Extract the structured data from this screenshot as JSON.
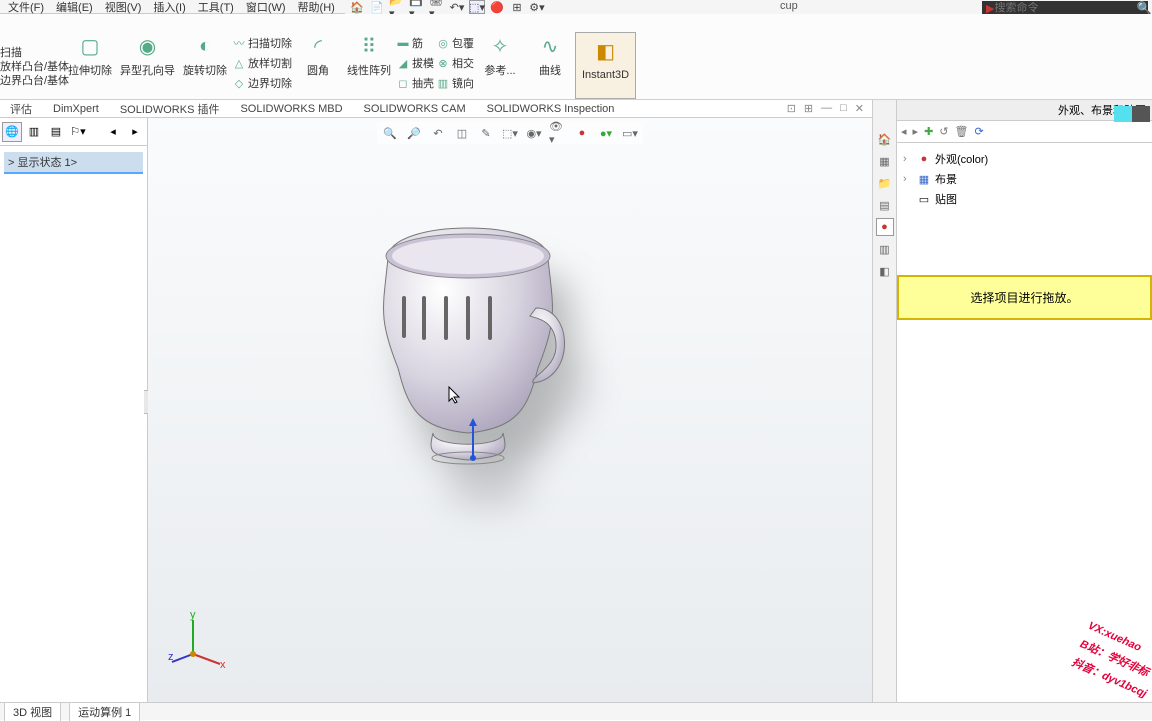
{
  "menu": {
    "file": "文件(F)",
    "edit": "编辑(E)",
    "view": "视图(V)",
    "insert": "插入(I)",
    "tools": "工具(T)",
    "window": "窗口(W)",
    "help": "帮助(H)"
  },
  "doc_title": "cup",
  "search": {
    "placeholder": "搜索命令"
  },
  "ribbon": {
    "left_feature_lines": "扫描\n放样凸台/基体\n边界凸台/基体",
    "extrude": "拉伸切除",
    "revolve": "旋转切除",
    "hole": "异型孔向导",
    "sweep_cut": "扫描切除",
    "loft_cut": "放样切割",
    "boundary_cut": "边界切除",
    "fillet": "圆角",
    "lpattern": "线性阵列",
    "rib": "筋",
    "draft": "拔模",
    "shell": "抽壳",
    "wrap": "包覆",
    "intersect": "相交",
    "mirror": "镜向",
    "refgeo": "参考...",
    "curves": "曲线",
    "instant3d": "Instant3D"
  },
  "tabs": {
    "evaluate": "评估",
    "dimxpert": "DimXpert",
    "plugins": "SOLIDWORKS 插件",
    "mbd": "SOLIDWORKS MBD",
    "cam": "SOLIDWORKS CAM",
    "inspection": "SOLIDWORKS Inspection"
  },
  "left_tree": {
    "display_state": "> 显示状态 1>"
  },
  "right": {
    "title": "外观、布景和贴图",
    "appearance": "外观(color)",
    "scene": "布景",
    "decal": "贴图",
    "drop_msg": "选择项目进行拖放。"
  },
  "bottom": {
    "view3d": "3D 视图",
    "motion": "运动算例 1"
  },
  "watermark": {
    "l1": "VX:xuehao",
    "l2": "B站：学好非标",
    "l3": "抖音：dyv1bcqj"
  }
}
